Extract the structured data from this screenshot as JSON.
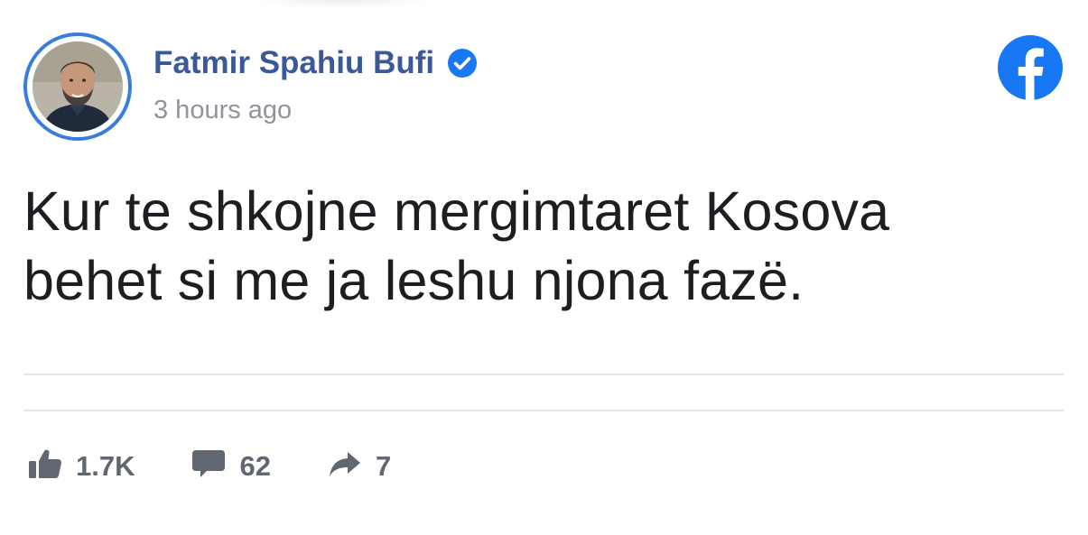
{
  "post": {
    "author": {
      "name": "Fatmir Spahiu Bufi",
      "verified": true,
      "avatar": "profile-photo"
    },
    "timestamp": "3 hours ago",
    "text": "Kur te shkojne mergimtaret Kosova\nbehet si me ja leshu njona fazë.",
    "platform_icon": "facebook-logo-icon"
  },
  "stats": {
    "likes": "1.7K",
    "comments": "62",
    "shares": "7"
  },
  "colors": {
    "brand_blue": "#1877f2",
    "name_blue": "#3b5998",
    "avatar_ring": "#3b7ddd",
    "muted_gray": "#90949c",
    "stat_gray": "#606770",
    "text": "#1c1e21",
    "divider": "#e5e5e5"
  },
  "icons": {
    "like": "thumbs-up-icon",
    "comment": "comment-bubble-icon",
    "share": "share-arrow-icon",
    "verified": "verified-check-icon"
  }
}
